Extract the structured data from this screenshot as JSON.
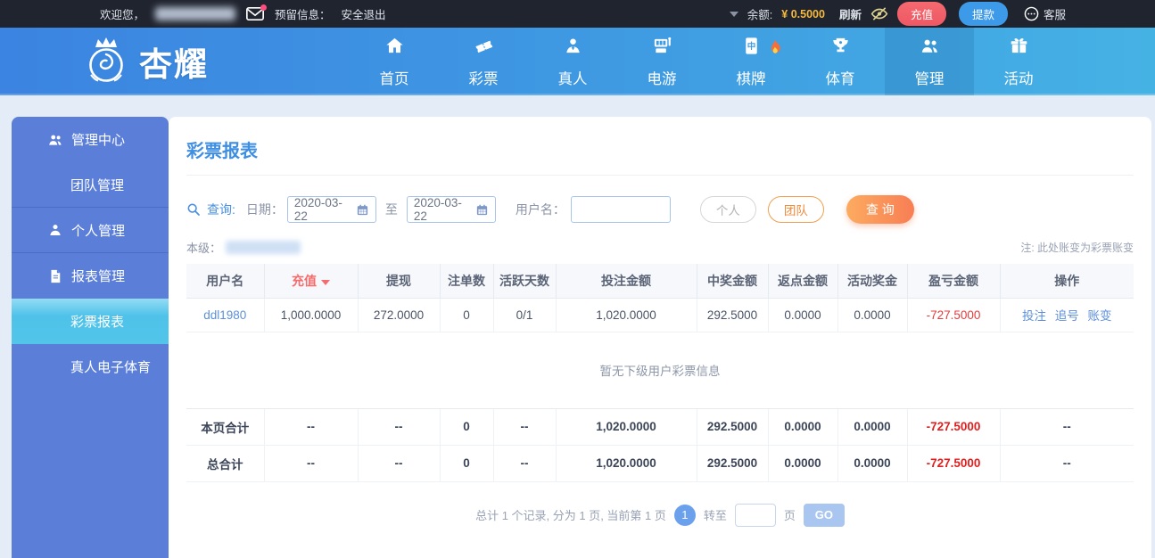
{
  "topbar": {
    "welcome": "欢迎您，",
    "reserved_label": "预留信息：",
    "logout": "安全退出",
    "balance_label": "余额:",
    "balance_value": "¥ 0.5000",
    "refresh": "刷新",
    "recharge": "充值",
    "withdraw": "提款",
    "service": "客服"
  },
  "nav": {
    "brand": "杏耀",
    "items": [
      {
        "label": "首页",
        "icon": "home-icon"
      },
      {
        "label": "彩票",
        "icon": "lottery-ticket-icon"
      },
      {
        "label": "真人",
        "icon": "live-person-icon"
      },
      {
        "label": "电游",
        "icon": "slot-machine-icon"
      },
      {
        "label": "棋牌",
        "icon": "mahjong-tile-icon",
        "badge": "hot-flame-icon"
      },
      {
        "label": "体育",
        "icon": "trophy-icon"
      },
      {
        "label": "管理",
        "icon": "users-icon",
        "active": true
      },
      {
        "label": "活动",
        "icon": "gift-icon"
      }
    ]
  },
  "sidebar": {
    "items": [
      {
        "label": "管理中心",
        "type": "header",
        "icon": "users-icon"
      },
      {
        "label": "团队管理",
        "type": "sub"
      },
      {
        "label": "个人管理",
        "type": "header",
        "icon": "user-icon"
      },
      {
        "label": "报表管理",
        "type": "header",
        "icon": "document-icon"
      },
      {
        "label": "彩票报表",
        "type": "sub",
        "active": true
      },
      {
        "label": "真人电子体育",
        "type": "sub"
      }
    ]
  },
  "main": {
    "title": "彩票报表",
    "search": {
      "query_label": "查询:",
      "date_label": "日期：",
      "date_from": "2020-03-22",
      "to_label": "至",
      "date_to": "2020-03-22",
      "username_label": "用户名：",
      "username_value": "",
      "personal_btn": "个人",
      "team_btn": "团队",
      "query_btn": "查 询"
    },
    "level_label": "本级：",
    "note": "注: 此处账变为彩票账变",
    "table": {
      "headers": [
        "用户名",
        "充值",
        "提现",
        "注单数",
        "活跃天数",
        "投注金额",
        "中奖金额",
        "返点金额",
        "活动奖金",
        "盈亏金额",
        "操作"
      ],
      "row": {
        "user": "ddl1980",
        "cells": [
          "1,000.0000",
          "272.0000",
          "0",
          "0/1",
          "1,020.0000",
          "292.5000",
          "0.0000",
          "0.0000"
        ],
        "profit": "-727.5000",
        "actions": [
          "投注",
          "追号",
          "账变"
        ]
      },
      "empty_text": "暂无下级用户彩票信息",
      "totals": [
        {
          "label": "本页合计",
          "cells": [
            "--",
            "--",
            "0",
            "--",
            "1,020.0000",
            "292.5000",
            "0.0000",
            "0.0000"
          ],
          "profit": "-727.5000",
          "op": "--"
        },
        {
          "label": "总合计",
          "cells": [
            "--",
            "--",
            "0",
            "--",
            "1,020.0000",
            "292.5000",
            "0.0000",
            "0.0000"
          ],
          "profit": "-727.5000",
          "op": "--"
        }
      ]
    },
    "pagination": {
      "summary": "总计 1 个记录, 分为 1 页, 当前第 1 页",
      "current_page": "1",
      "goto_label": "转至",
      "page_unit": "页",
      "go_label": "GO"
    }
  },
  "colors": {
    "topbar_bg": "#20242f",
    "nav_blue_left": "#3b84e1",
    "nav_blue_right": "#45b2e4",
    "sidebar_blue": "#5b7fd9",
    "active_cyan": "#4ec3e9",
    "title_blue": "#3e8ee2",
    "query_orange": "#f8824e",
    "negative_red": "#e01f1f",
    "balance_gold": "#f5b93c",
    "link_blue": "#5d8fd8"
  }
}
